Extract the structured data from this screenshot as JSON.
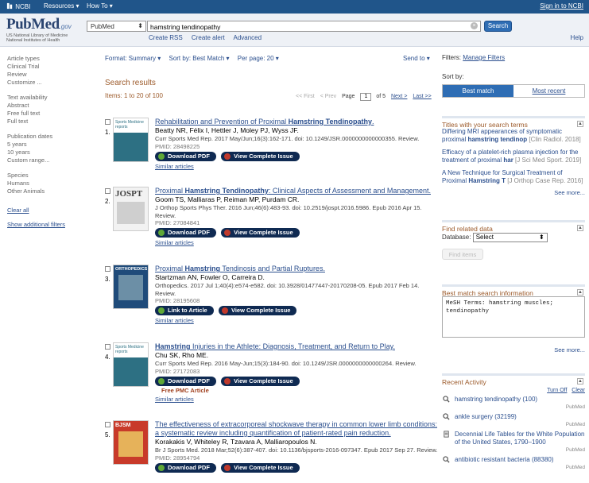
{
  "topbar": {
    "ncbi": "NCBI",
    "resources": "Resources",
    "howto": "How To",
    "signin": "Sign in to NCBI"
  },
  "logo": {
    "name": "PubMed",
    "gov": ".gov",
    "sub1": "US National Library of Medicine",
    "sub2": "National Institutes of Health"
  },
  "search": {
    "database": "PubMed",
    "query": "hamstring tendinopathy",
    "button": "Search",
    "create_rss": "Create RSS",
    "create_alert": "Create alert",
    "advanced": "Advanced",
    "help": "Help"
  },
  "filters_left": {
    "article_types": "Article types",
    "clinical_trial": "Clinical Trial",
    "review": "Review",
    "customize": "Customize ...",
    "text_availability": "Text availability",
    "abstract": "Abstract",
    "free_full_text": "Free full text",
    "full_text": "Full text",
    "pub_dates": "Publication dates",
    "five_years": "5 years",
    "ten_years": "10 years",
    "custom_range": "Custom range...",
    "species": "Species",
    "humans": "Humans",
    "other_animals": "Other Animals",
    "clear_all": "Clear all",
    "show_additional": "Show additional filters"
  },
  "toolbar": {
    "format": "Format: Summary ▾",
    "sort": "Sort by: Best Match ▾",
    "perpage": "Per page: 20 ▾",
    "sendto": "Send to ▾"
  },
  "results_header": {
    "title": "Search results",
    "items": "Items: 1 to 20 of 100",
    "first": "<< First",
    "prev": "< Prev",
    "page_label": "Page",
    "page_value": "1",
    "of": "of 5",
    "next": "Next >",
    "last": "Last >>"
  },
  "results": [
    {
      "num": "1.",
      "title_pre": "Rehabilitation and Prevention of Proximal ",
      "title_bold": "Hamstring Tendinopathy",
      "title_post": ".",
      "authors": "Beatty NR, Félix I, Hettler J, Moley PJ, Wyss JF.",
      "citation": "Curr Sports Med Rep. 2017 May/Jun;16(3):162-171. doi: 10.1249/JSR.0000000000000355. Review.",
      "pmid": "PMID: 28498225",
      "btn1": "Download PDF",
      "btn2": "View Complete Issue",
      "similar": "Similar articles",
      "free": ""
    },
    {
      "num": "2.",
      "title_pre": "Proximal ",
      "title_bold": "Hamstring Tendinopathy",
      "title_post": ": Clinical Aspects of Assessment and Management.",
      "authors": "Goom TS, Malliaras P, Reiman MP, Purdam CR.",
      "citation": "J Orthop Sports Phys Ther. 2016 Jun;46(6):483-93. doi: 10.2519/jospt.2016.5986. Epub 2016 Apr 15. Review.",
      "pmid": "PMID: 27084841",
      "btn1": "Download PDF",
      "btn2": "View Complete Issue",
      "similar": "Similar articles",
      "free": ""
    },
    {
      "num": "3.",
      "title_pre": "Proximal ",
      "title_bold": "Hamstring",
      "title_post": " Tendinosis and Partial Ruptures.",
      "authors": "Startzman AN, Fowler O, Carreira D.",
      "citation": "Orthopedics. 2017 Jul 1;40(4):e574-e582. doi: 10.3928/01477447-20170208-05. Epub 2017 Feb 14. Review.",
      "pmid": "PMID: 28195608",
      "btn1": "Link to Article",
      "btn2": "View Complete Issue",
      "similar": "Similar articles",
      "free": ""
    },
    {
      "num": "4.",
      "title_pre": "",
      "title_bold": "Hamstring",
      "title_post": " Injuries in the Athlete: Diagnosis, Treatment, and Return to Play.",
      "authors": "Chu SK, Rho ME.",
      "citation": "Curr Sports Med Rep. 2016 May-Jun;15(3):184-90. doi: 10.1249/JSR.0000000000000264. Review.",
      "pmid": "PMID: 27172083",
      "btn1": "Download PDF",
      "btn2": "View Complete Issue",
      "similar": "Similar articles",
      "free": "Free PMC Article"
    },
    {
      "num": "5.",
      "title_pre": "The effectiveness of extracorporeal shockwave therapy in common lower limb conditions: a systematic review including quantification of patient-rated pain reduction.",
      "title_bold": "",
      "title_post": "",
      "authors": "Korakakis V, Whiteley R, Tzavara A, Malliaropoulos N.",
      "citation": "Br J Sports Med. 2018 Mar;52(6):387-407. doi: 10.1136/bjsports-2016-097347. Epub 2017 Sep 27. Review.",
      "pmid": "PMID: 28954794",
      "btn1": "Download PDF",
      "btn2": "View Complete Issue",
      "similar": "",
      "free": ""
    }
  ],
  "thumbs": {
    "t1": "Sports Medicine reports",
    "t2": "JOSPT",
    "t3": "ORTHOPEDICS",
    "t4": "Sports Medicine reports",
    "t5": "BJSM"
  },
  "right": {
    "filters_label": "Filters:",
    "manage_filters": "Manage Filters",
    "sort_by": "Sort by:",
    "best_match": "Best match",
    "most_recent": "Most recent",
    "titles_header": "Titles with your search terms",
    "t1_pre": "Differing MRI appearances of symptomatic proximal ",
    "t1_bold": "hamstring tendinop",
    "t1_src": " [Clin Radiol. 2018]",
    "t2_pre": "Efficacy of a platelet-rich plasma injection for the treatment of proximal ",
    "t2_bold": "har",
    "t2_src": " [J Sci Med Sport. 2019]",
    "t3_pre": "A New Technique for Surgical Treatment of Proximal ",
    "t3_bold": "Hamstring T",
    "t3_src": " [J Orthop Case Rep. 2016]",
    "see_more1": "See more...",
    "find_related": "Find related data",
    "database_label": "Database:",
    "database_value": "Select",
    "find_items": "Find items",
    "best_match_info": "Best match search information",
    "mesh": "MeSH Terms: hamstring muscles; tendinopathy",
    "see_more2": "See more...",
    "recent_activity": "Recent Activity",
    "turn_off": "Turn Off",
    "clear": "Clear",
    "ra1": "hamstring tendinopathy (100)",
    "ra1_src": "PubMed",
    "ra2": "ankle surgery (32199)",
    "ra2_src": "PubMed",
    "ra3": "Decennial Life Tables for the White Population of the United States, 1790–1900",
    "ra3_src": "PubMed",
    "ra4": "antibiotic resistant bacteria (88380)",
    "ra4_src": "PubMed"
  }
}
